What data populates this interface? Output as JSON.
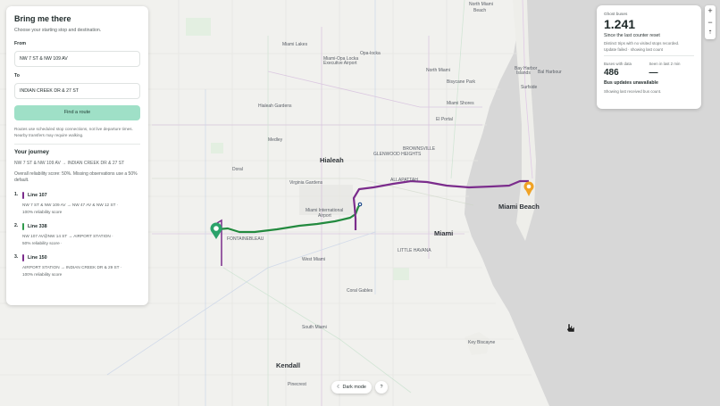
{
  "route_panel": {
    "title": "Bring me there",
    "subtitle": "Choose your starting stop and destination.",
    "from_label": "From",
    "from_value": "NW 7 ST & NW 109 AV",
    "to_label": "To",
    "to_value": "INDIAN CREEK DR & 27 ST",
    "find_button": "Find a route",
    "note": "Routes use scheduled stop connections, not live departure times. Nearby transfers may require walking."
  },
  "journey": {
    "title": "Your journey",
    "summary": "NW 7 ST & NW 109 AV → INDIAN CREEK DR & 27 ST",
    "reliability": "Overall reliability score: 50%. Missing observations use a 50% default.",
    "legs": [
      {
        "num": "1.",
        "line": "Line 107",
        "color": "#7b2c8c",
        "stops": "NW 7 ST & NW 109 AV → NW 47 AV & NW 12 ST ·",
        "score": "100% reliability score"
      },
      {
        "num": "2.",
        "line": "Line 338",
        "color": "#2f9a4b",
        "stops": "NW 107 AV@NW 14 ST → AIRPORT STATION ·",
        "score": "50% reliability score ·"
      },
      {
        "num": "3.",
        "line": "Line 150",
        "color": "#7b2c8c",
        "stops": "AIRPORT STATION → INDIAN CREEK DR & 29 ST ·",
        "score": "100% reliability score"
      }
    ]
  },
  "stats": {
    "title": "Ghost buses",
    "count": "1.241",
    "since": "Since the last counter reset",
    "distinct": "Distinct trips with no visited stops recorded.",
    "update": "Update failed · showing last count",
    "buses_label": "Buses with data",
    "buses_value": "486",
    "seen_label": "Seen in last 2 min",
    "seen_value": "—",
    "unavailable": "Bus updates unavailable",
    "showing": "Showing last received bus count."
  },
  "zoom": {
    "in": "+",
    "out": "−",
    "reset": "⇡"
  },
  "controls": {
    "dark_mode": "☾ Dark mode",
    "info": "?"
  },
  "map": {
    "cities": [
      {
        "name": "Hialeah"
      },
      {
        "name": "Miami"
      },
      {
        "name": "Miami Beach"
      },
      {
        "name": "Kendall"
      }
    ],
    "places": [
      {
        "name": "North Miami Beach"
      },
      {
        "name": "Miami Lakes"
      },
      {
        "name": "Opa-locka"
      },
      {
        "name": "Miami-Opa Locka Executive Airport"
      },
      {
        "name": "North Miami"
      },
      {
        "name": "Bay Harbor Islands"
      },
      {
        "name": "Bal Harbour"
      },
      {
        "name": "Bisycane Park"
      },
      {
        "name": "Surfside"
      },
      {
        "name": "Miami Shores"
      },
      {
        "name": "El Portal"
      },
      {
        "name": "Hialeah Gardens"
      },
      {
        "name": "Medley"
      },
      {
        "name": "Doral"
      },
      {
        "name": "Virginia Gardens"
      },
      {
        "name": "Miami International Airport"
      },
      {
        "name": "Fontainebleau"
      },
      {
        "name": "West Miami"
      },
      {
        "name": "Coral Gables"
      },
      {
        "name": "South Miami"
      },
      {
        "name": "Key Biscayne"
      },
      {
        "name": "Pinecrest"
      },
      {
        "name": "Brownsville"
      },
      {
        "name": "Allapattah"
      },
      {
        "name": "Little Havana"
      },
      {
        "name": "Glenwood Heights"
      }
    ]
  }
}
